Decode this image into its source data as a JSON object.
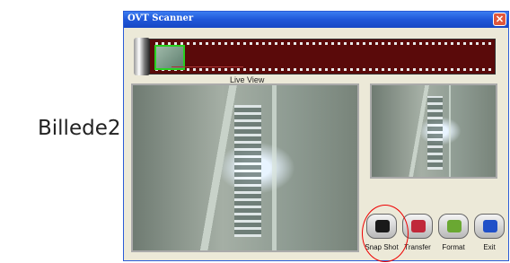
{
  "caption": "Billede2",
  "window": {
    "title": "OVT Scanner",
    "close_label": "✕"
  },
  "live_view_label": "Live View",
  "buttons": [
    {
      "label": "Snap Shot",
      "icon": "camera-icon",
      "color": "#1a1a1a"
    },
    {
      "label": "Transfer",
      "icon": "transfer-icon",
      "color": "#c0283a"
    },
    {
      "label": "Format",
      "icon": "format-icon",
      "color": "#6aa832"
    },
    {
      "label": "Exit",
      "icon": "exit-door-icon",
      "color": "#2050c8"
    }
  ]
}
